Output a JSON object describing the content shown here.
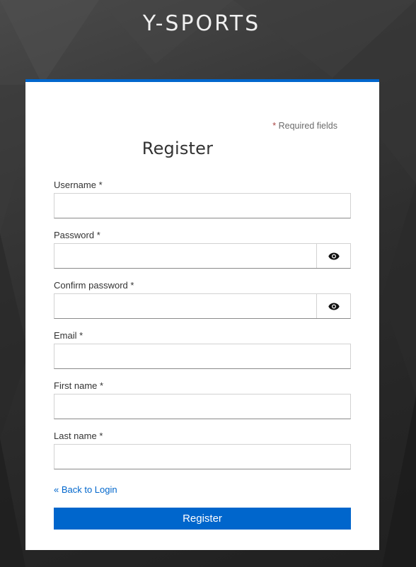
{
  "brand": "Y-SPORTS",
  "required_note": {
    "star": "*",
    "text": "Required fields"
  },
  "title": "Register",
  "fields": {
    "username": {
      "label": "Username *",
      "value": "",
      "placeholder": ""
    },
    "password": {
      "label": "Password *",
      "value": "",
      "placeholder": ""
    },
    "confirm_password": {
      "label": "Confirm password *",
      "value": "",
      "placeholder": ""
    },
    "email": {
      "label": "Email *",
      "value": "",
      "placeholder": ""
    },
    "first_name": {
      "label": "First name *",
      "value": "",
      "placeholder": ""
    },
    "last_name": {
      "label": "Last name *",
      "value": "",
      "placeholder": ""
    }
  },
  "back_link": "« Back to Login",
  "submit_label": "Register",
  "icons": {
    "password_toggle": "eye-icon",
    "confirm_toggle": "eye-icon"
  },
  "colors": {
    "accent": "#0066cc",
    "required_star": "#a94442"
  }
}
